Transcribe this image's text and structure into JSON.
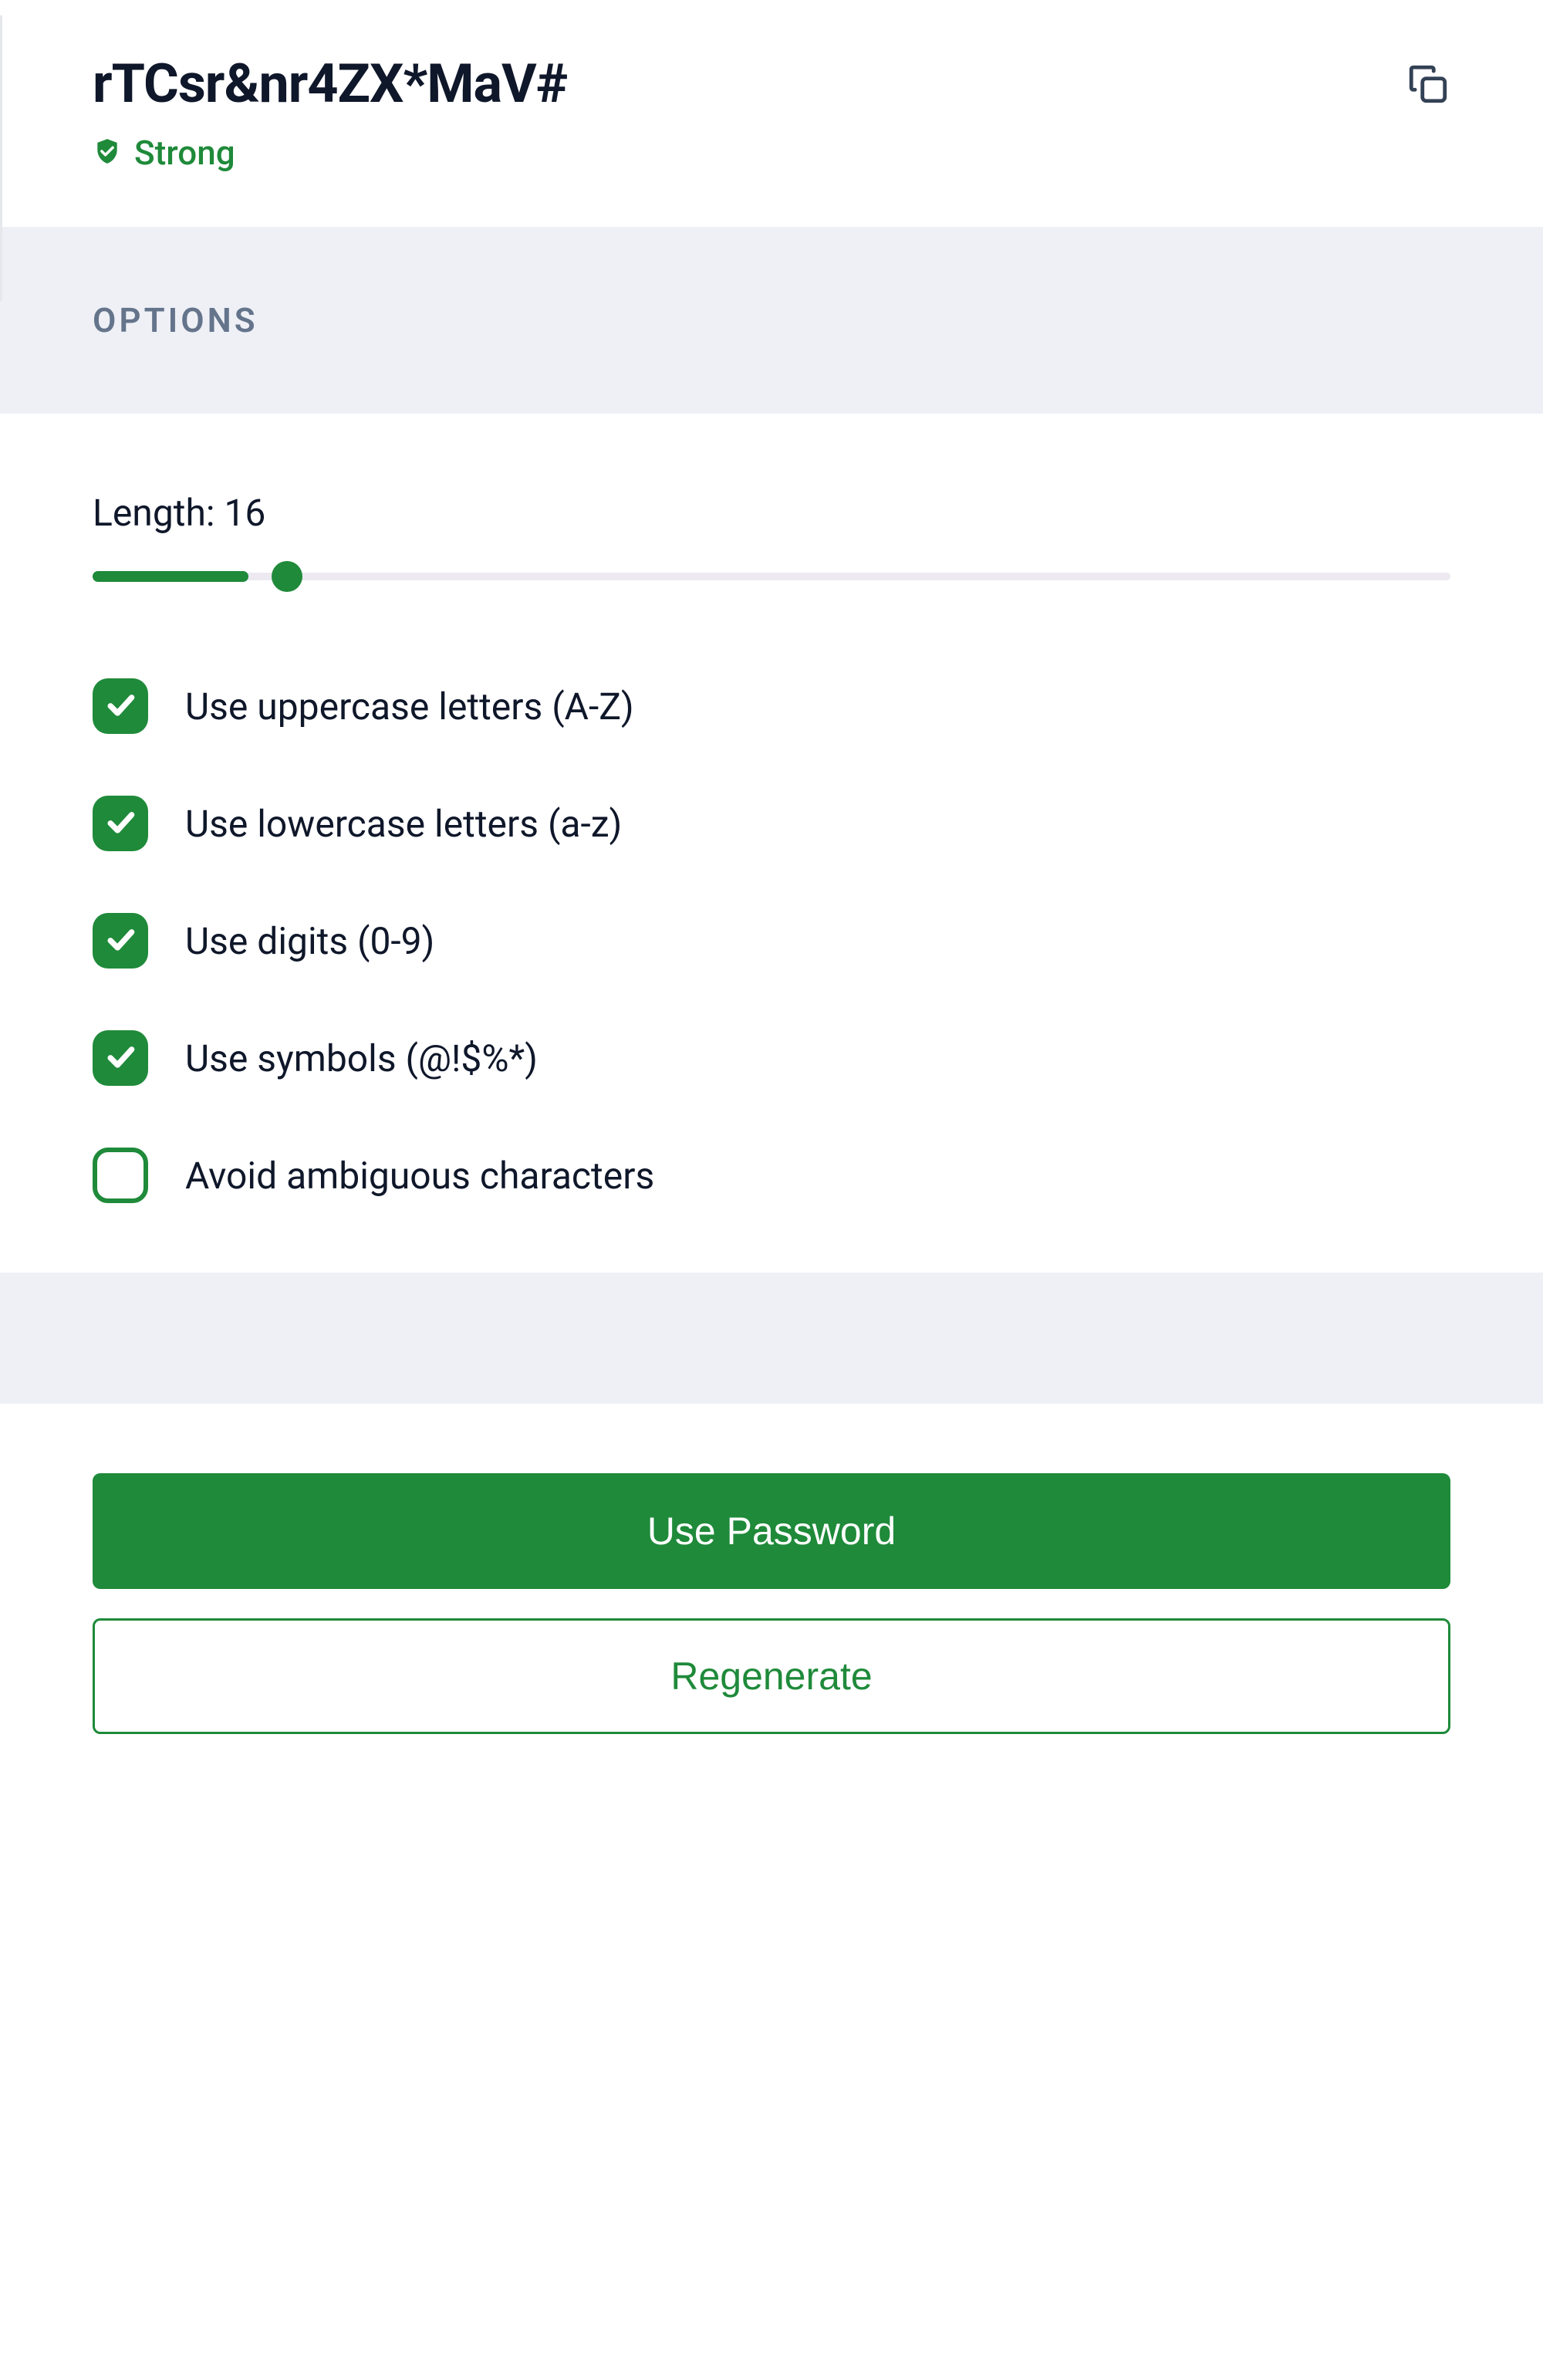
{
  "header": {
    "password": "rTCsr&nr4ZX*MaV#",
    "strength_label": "Strong"
  },
  "section": {
    "title": "OPTIONS"
  },
  "options": {
    "length_prefix": "Length: ",
    "length_value": 16,
    "slider": {
      "min": 4,
      "max": 64,
      "value": 16,
      "fill_percent": 11.5,
      "thumb_percent": 14.3
    },
    "checks": [
      {
        "label": "Use uppercase letters (A-Z)",
        "checked": true
      },
      {
        "label": "Use lowercase letters (a-z)",
        "checked": true
      },
      {
        "label": "Use digits (0-9)",
        "checked": true
      },
      {
        "label": "Use symbols (@!$%*)",
        "checked": true
      },
      {
        "label": "Avoid ambiguous characters",
        "checked": false
      }
    ]
  },
  "footer": {
    "primary_label": "Use Password",
    "secondary_label": "Regenerate"
  },
  "colors": {
    "accent": "#1f8a3a",
    "section_bg": "#eef0f6",
    "text_muted": "#64748b",
    "track": "#ece9f1"
  }
}
